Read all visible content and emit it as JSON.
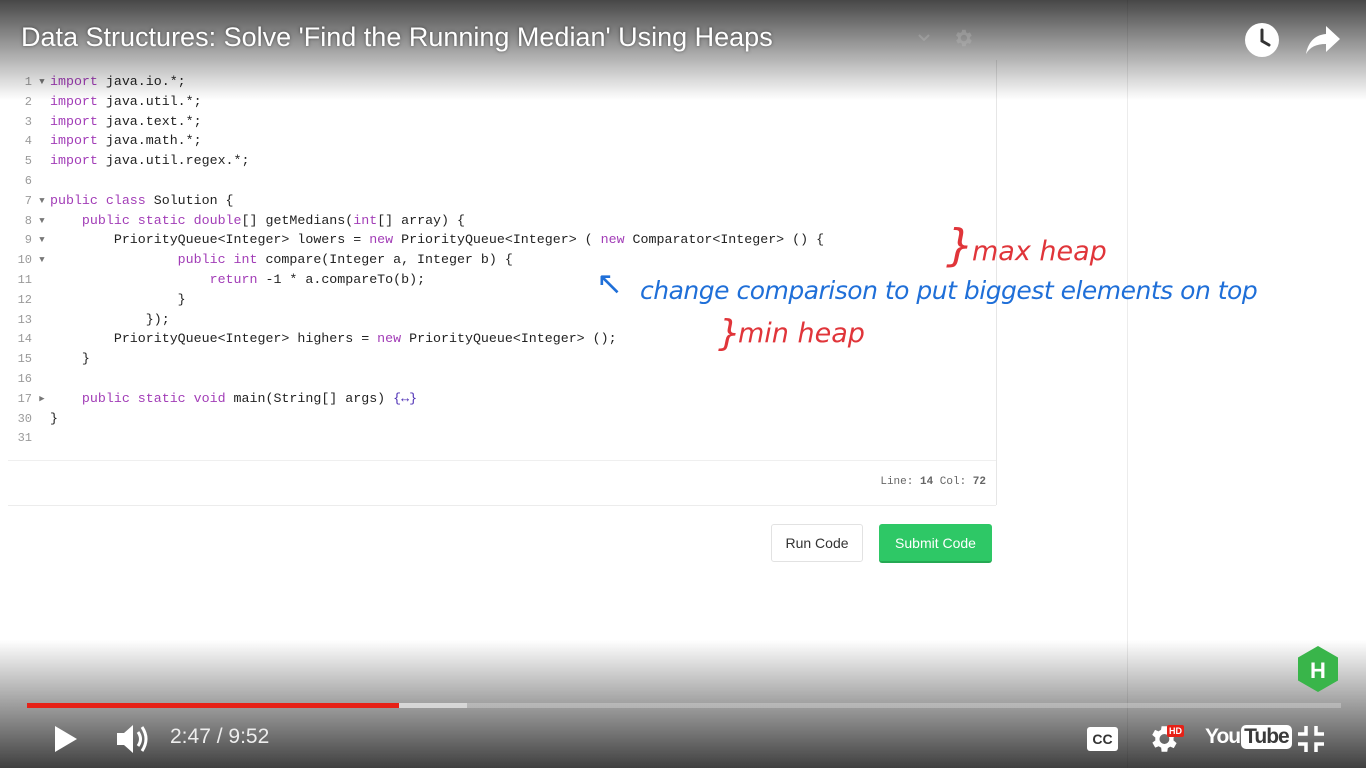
{
  "video": {
    "title": "Data Structures: Solve 'Find the Running Median' Using Heaps",
    "current_time": "2:47",
    "duration": "9:52",
    "time_separator": "/",
    "progress": 0.283,
    "buffered": 0.335
  },
  "editor": {
    "lines": [
      {
        "num": "1",
        "fold": "▼",
        "code": [
          {
            "t": "import",
            "c": "kw"
          },
          {
            "t": " java.io.*;"
          }
        ]
      },
      {
        "num": "2",
        "fold": "",
        "code": [
          {
            "t": "import",
            "c": "kw"
          },
          {
            "t": " java.util.*;"
          }
        ]
      },
      {
        "num": "3",
        "fold": "",
        "code": [
          {
            "t": "import",
            "c": "kw"
          },
          {
            "t": " java.text.*;"
          }
        ]
      },
      {
        "num": "4",
        "fold": "",
        "code": [
          {
            "t": "import",
            "c": "kw"
          },
          {
            "t": " java.math.*;"
          }
        ]
      },
      {
        "num": "5",
        "fold": "",
        "code": [
          {
            "t": "import",
            "c": "kw"
          },
          {
            "t": " java.util.regex.*;"
          }
        ]
      },
      {
        "num": "6",
        "fold": "",
        "code": []
      },
      {
        "num": "7",
        "fold": "▼",
        "code": [
          {
            "t": "public class",
            "c": "kw"
          },
          {
            "t": " Solution {"
          }
        ]
      },
      {
        "num": "8",
        "fold": "▼",
        "code": [
          {
            "t": "    "
          },
          {
            "t": "public static",
            "c": "kw"
          },
          {
            "t": " "
          },
          {
            "t": "double",
            "c": "kw"
          },
          {
            "t": "[] getMedians("
          },
          {
            "t": "int",
            "c": "kw"
          },
          {
            "t": "[] array) {"
          }
        ]
      },
      {
        "num": "9",
        "fold": "▼",
        "code": [
          {
            "t": "        PriorityQueue<Integer> lowers = "
          },
          {
            "t": "new",
            "c": "kw"
          },
          {
            "t": " PriorityQueue<Integer> ( "
          },
          {
            "t": "new",
            "c": "kw"
          },
          {
            "t": " Comparator<Integer> () {"
          }
        ]
      },
      {
        "num": "10",
        "fold": "▼",
        "code": [
          {
            "t": "                "
          },
          {
            "t": "public int",
            "c": "kw"
          },
          {
            "t": " compare(Integer a, Integer b) {"
          }
        ]
      },
      {
        "num": "11",
        "fold": "",
        "code": [
          {
            "t": "                    "
          },
          {
            "t": "return",
            "c": "kw"
          },
          {
            "t": " -1 * a.compareTo(b);"
          }
        ]
      },
      {
        "num": "12",
        "fold": "",
        "code": [
          {
            "t": "                }"
          }
        ]
      },
      {
        "num": "13",
        "fold": "",
        "code": [
          {
            "t": "            });"
          }
        ]
      },
      {
        "num": "14",
        "fold": "",
        "code": [
          {
            "t": "        PriorityQueue<Integer> highers = "
          },
          {
            "t": "new",
            "c": "kw"
          },
          {
            "t": " PriorityQueue<Integer> ();"
          }
        ]
      },
      {
        "num": "15",
        "fold": "",
        "code": [
          {
            "t": "    }"
          }
        ]
      },
      {
        "num": "16",
        "fold": "",
        "code": []
      },
      {
        "num": "17",
        "fold": "▶",
        "code": [
          {
            "t": "    "
          },
          {
            "t": "public static void",
            "c": "kw"
          },
          {
            "t": " main(String[] args) "
          },
          {
            "t": "{↔}",
            "c": "kw2"
          }
        ]
      },
      {
        "num": "30",
        "fold": "",
        "code": [
          {
            "t": "}"
          }
        ]
      },
      {
        "num": "31",
        "fold": "",
        "code": []
      }
    ],
    "status_line_label": "Line:",
    "status_line_value": "14",
    "status_col_label": "Col:",
    "status_col_value": "72"
  },
  "buttons": {
    "run_label": "Run Code",
    "submit_label": "Submit Code"
  },
  "annotations": {
    "max_heap": "max heap",
    "min_heap": "min heap",
    "change_note": "change comparison to put biggest elements on top",
    "max_brace": "}",
    "min_brace": "}",
    "arrow": "↖"
  },
  "controls": {
    "cc_label": "CC",
    "hd_badge": "HD",
    "youtube_you": "You",
    "youtube_tube": "Tube"
  },
  "logo": {
    "letter": "H"
  },
  "colors": {
    "progress_played": "#e62117",
    "submit_green": "#2ec866",
    "annotation_red": "#e0353a",
    "annotation_blue": "#1f6fd8",
    "keyword_purple": "#a23db7",
    "hackerrank_green": "#39b54a"
  },
  "icons": [
    "play-icon",
    "volume-icon",
    "clock-icon",
    "share-icon",
    "settings-icon",
    "fullscreen-exit-icon",
    "hackerrank-logo-icon"
  ]
}
